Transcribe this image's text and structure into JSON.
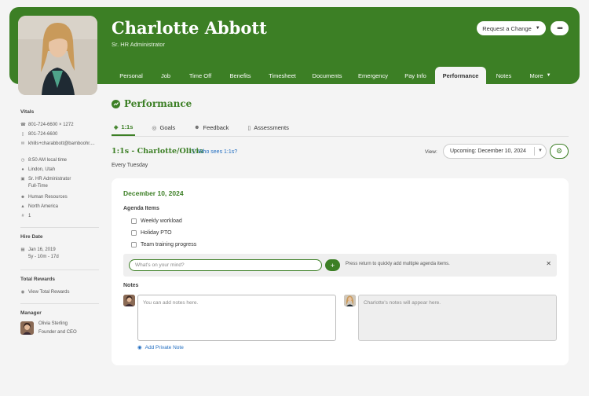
{
  "profile": {
    "name": "Charlotte Abbott",
    "job_title": "Sr. HR Administrator",
    "request_change_label": "Request a Change",
    "more_label": "•••"
  },
  "tabs": [
    {
      "label": "Personal"
    },
    {
      "label": "Job"
    },
    {
      "label": "Time Off"
    },
    {
      "label": "Benefits"
    },
    {
      "label": "Timesheet"
    },
    {
      "label": "Documents"
    },
    {
      "label": "Emergency"
    },
    {
      "label": "Pay Info"
    },
    {
      "label": "Performance",
      "active": true
    },
    {
      "label": "Notes"
    },
    {
      "label": "More"
    }
  ],
  "sidebar": {
    "vitals_heading": "Vitals",
    "work_phone": "801-724-6600 × 1272",
    "mobile_phone": "801-724-6600",
    "email": "khills+charabbott@bamboohr....",
    "local_time": "8:50 AM local time",
    "location": "Lindon, Utah",
    "job": "Sr. HR Administrator",
    "employment_type": "Full-Time",
    "department": "Human Resources",
    "region": "North America",
    "employee_number": "1",
    "hire_heading": "Hire Date",
    "hire_date": "Jan 16, 2019",
    "tenure": "5y - 10m - 17d",
    "rewards_heading": "Total Rewards",
    "rewards_link": "View Total Rewards",
    "manager_heading": "Manager",
    "manager_name": "Olivia Sterling",
    "manager_title": "Founder and CEO"
  },
  "performance": {
    "title": "Performance",
    "subtabs": [
      {
        "label": "1:1s",
        "active": true
      },
      {
        "label": "Goals"
      },
      {
        "label": "Feedback"
      },
      {
        "label": "Assessments"
      }
    ],
    "ones_title": "1:1s - Charlotte/Olivia",
    "who_sees": "Who sees 1:1s?",
    "frequency": "Every Tuesday",
    "view_label": "View:",
    "view_value": "Upcoming: December 10, 2024"
  },
  "meeting": {
    "date": "December 10, 2024",
    "agenda_heading": "Agenda Items",
    "agenda_items": [
      "Weekly workload",
      "Holiday PTO",
      "Team training progress"
    ],
    "input_placeholder": "What's on your mind?",
    "add_label": "+",
    "hint": "Press return to quickly add multiple agenda items.",
    "close_label": "✕",
    "notes_heading": "Notes",
    "own_notes_placeholder": "You can add notes here.",
    "other_notes_placeholder": "Charlotte's notes will appear here.",
    "private_note_label": "Add Private Note"
  },
  "colors": {
    "brand_green": "#3c7f25",
    "link_blue": "#1f6cc0"
  }
}
